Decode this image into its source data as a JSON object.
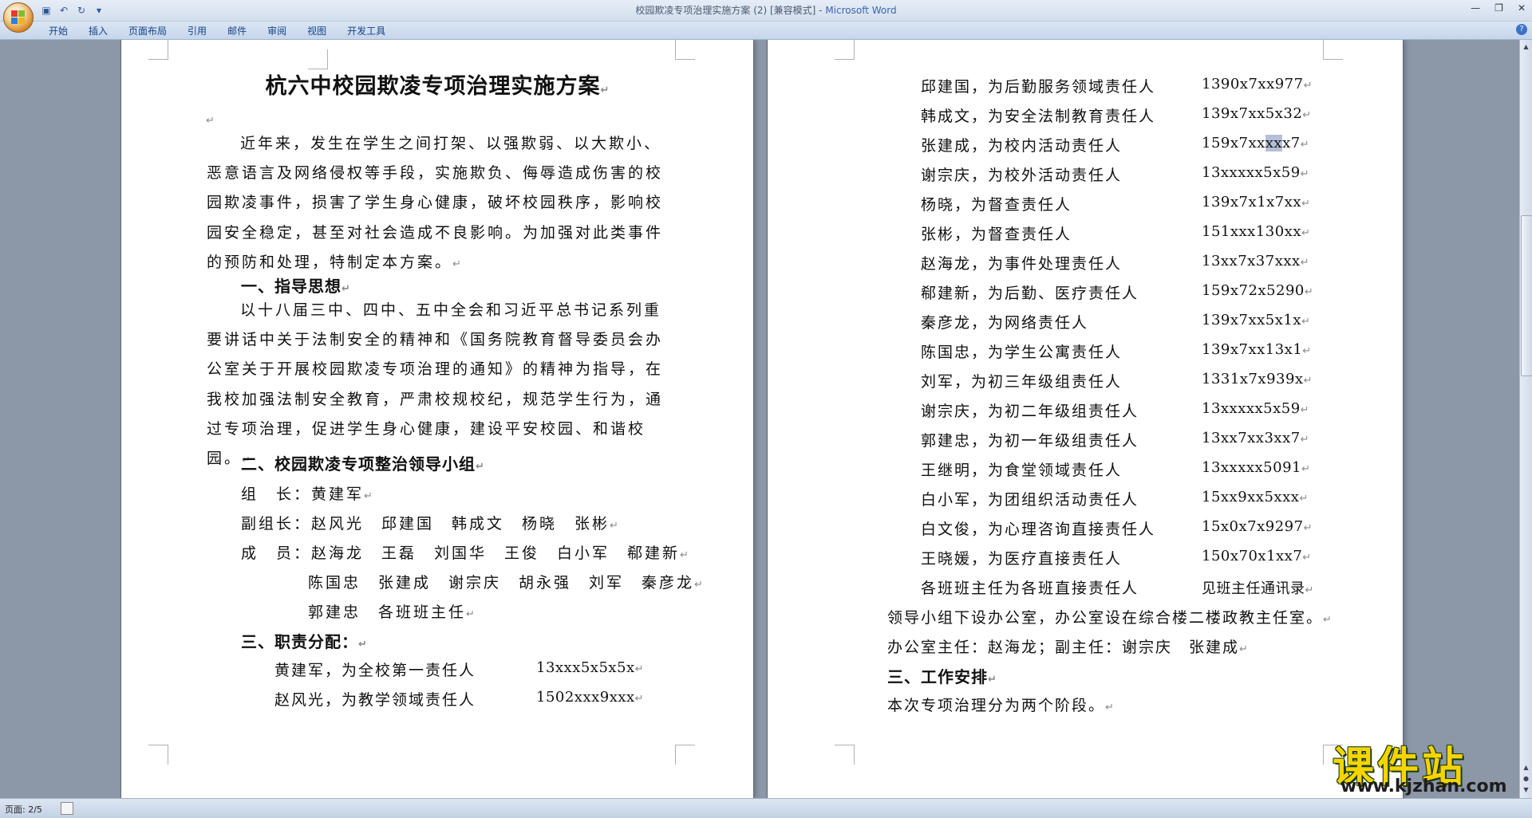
{
  "window": {
    "title": "校园欺凌专项治理实施方案 (2) [兼容模式] - ",
    "app_name": "Microsoft Word",
    "controls": [
      "—",
      "❐",
      "✕"
    ]
  },
  "quick_access": [
    "save-icon",
    "undo-icon",
    "redo-icon",
    "customize-icon"
  ],
  "ribbon": {
    "tabs": [
      "开始",
      "插入",
      "页面布局",
      "引用",
      "邮件",
      "审阅",
      "视图",
      "开发工具"
    ]
  },
  "left_page": {
    "title": "杭六中校园欺凌专项治理实施方案",
    "intro": "近年来，发生在学生之间打架、以强欺弱、以大欺小、恶意语言及网络侵权等手段，实施欺负、侮辱造成伤害的校园欺凌事件，损害了学生身心健康，破坏校园秩序，影响校园安全稳定，甚至对社会造成不良影响。为加强对此类事件的预防和处理，特制定本方案。",
    "h1": "一、指导思想",
    "guide": "以十八届三中、四中、五中全会和习近平总书记系列重要讲话中关于法制安全的精神和《国务院教育督导委员会办公室关于开展校园欺凌专项治理的通知》的精神为指导，在我校加强法制安全教育，严肃校规校纪，规范学生行为，通过专项治理，促进学生身心健康，建设平安校园、和谐校园。",
    "h2": "二、校园欺凌专项整治领导小组",
    "leader": "组　长：黄建军",
    "deputy": "副组长：赵风光　邱建国　韩成文　杨晓　张彬",
    "members1": "成　员：赵海龙　王磊　刘国华　王俊　白小军　郗建新",
    "members2": "陈国忠　张建成　谢宗庆　胡永强　刘军　秦彦龙",
    "members3": "郭建忠　各班班主任",
    "h3": "三、职责分配：",
    "duties": [
      {
        "name": "黄建军，为全校第一责任人",
        "phone": "13xxx5x5x5x"
      },
      {
        "name": "赵风光，为教学领域责任人",
        "phone": "1502xxx9xxx"
      }
    ]
  },
  "right_page": {
    "duties": [
      {
        "name": "邱建国，为后勤服务领域责任人",
        "phone": "1390x7xx977"
      },
      {
        "name": "韩成文，为安全法制教育责任人",
        "phone": "139x7xx5x32"
      },
      {
        "name": "张建成，为校内活动责任人",
        "phone_pre": "159x7xx",
        "phone_sel": "xx",
        "phone_post": "x7"
      },
      {
        "name": "谢宗庆，为校外活动责任人",
        "phone": "13xxxxx5x59"
      },
      {
        "name": "杨晓，为督查责任人",
        "phone": "139x7x1x7xx"
      },
      {
        "name": "张彬，为督查责任人",
        "phone": "151xxx130xx"
      },
      {
        "name": "赵海龙，为事件处理责任人",
        "phone": "13xx7x37xxx"
      },
      {
        "name": "郗建新，为后勤、医疗责任人",
        "phone": "159x72x5290"
      },
      {
        "name": "秦彦龙，为网络责任人",
        "phone": "139x7xx5x1x"
      },
      {
        "name": "陈国忠，为学生公寓责任人",
        "phone": "139x7xx13x1"
      },
      {
        "name": "刘军，为初三年级组责任人",
        "phone": "1331x7x939x"
      },
      {
        "name": "谢宗庆，为初二年级组责任人",
        "phone": "13xxxxx5x59"
      },
      {
        "name": "郭建忠，为初一年级组责任人",
        "phone": "13xx7xx3xx7"
      },
      {
        "name": "王继明，为食堂领域责任人",
        "phone": "13xxxxx5091"
      },
      {
        "name": "白小军，为团组织活动责任人",
        "phone": "15xx9xx5xxx"
      },
      {
        "name": "白文俊，为心理咨询直接责任人",
        "phone": "15x0x7x9297"
      },
      {
        "name": "王晓媛，为医疗直接责任人",
        "phone": "150x70x1xx7"
      },
      {
        "name": "各班班主任为各班直接责任人",
        "phone": "见班主任通讯录"
      }
    ],
    "office": "领导小组下设办公室，办公室设在综合楼二楼政教主任室。",
    "office_director": "办公室主任：赵海龙；副主任：谢宗庆　张建成",
    "h3": "三、工作安排",
    "schedule": "本次专项治理分为两个阶段。"
  },
  "statusbar": {
    "page": "页面: 2/5"
  },
  "watermark": {
    "cn": "课件站",
    "url": "www.kjzhan.com"
  },
  "pilcrow": "↵",
  "colors": {
    "ribbon_text": "#15428b",
    "selection": "#b5bfd6",
    "workspace": "#8c97a8"
  }
}
